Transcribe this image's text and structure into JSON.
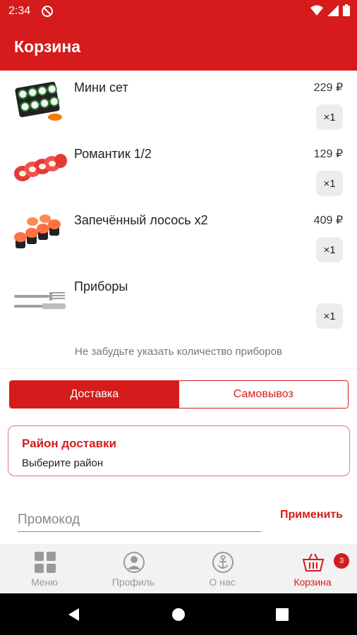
{
  "status_bar": {
    "time": "2:34"
  },
  "header": {
    "title": "Корзина"
  },
  "cart": {
    "items": [
      {
        "name": "Мини сет",
        "price": "229 ₽",
        "qty": "×1",
        "image_icon": "sushi-set-icon"
      },
      {
        "name": "Романтик 1/2",
        "price": "129 ₽",
        "qty": "×1",
        "image_icon": "red-rolls-icon"
      },
      {
        "name": "Запечённый лосось x2",
        "price": "409 ₽",
        "qty": "×1",
        "image_icon": "baked-rolls-icon"
      },
      {
        "name": "Приборы",
        "price": "",
        "qty": "×1",
        "image_icon": "cutlery-icon"
      }
    ],
    "utensils_note": "Не забудьте указать количество приборов"
  },
  "delivery": {
    "options": [
      "Доставка",
      "Самовывоз"
    ],
    "selected": "Доставка"
  },
  "district": {
    "title": "Район доставки",
    "value": "Выберите район"
  },
  "promo": {
    "placeholder": "Промокод",
    "apply_label": "Применить"
  },
  "bottom_nav": {
    "items": [
      {
        "label": "Меню",
        "icon": "grid-icon"
      },
      {
        "label": "Профиль",
        "icon": "user-icon"
      },
      {
        "label": "О нас",
        "icon": "anchor-icon"
      },
      {
        "label": "Корзина",
        "icon": "basket-icon"
      }
    ],
    "active": "Корзина",
    "cart_badge": "3"
  },
  "colors": {
    "primary": "#d51b1b",
    "nav_inactive": "#999999",
    "nav_bg": "#f2f2f2"
  }
}
